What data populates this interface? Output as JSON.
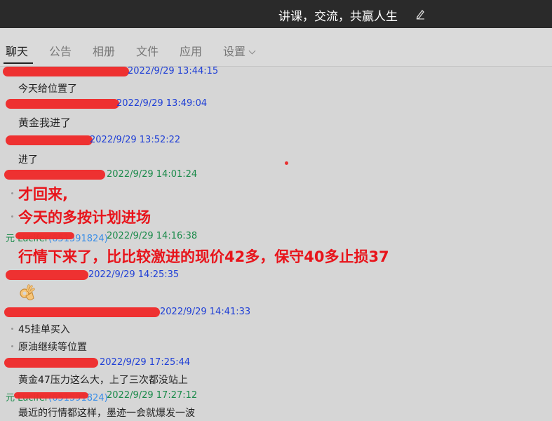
{
  "header": {
    "group_name": "讲课，交流，共赢人生"
  },
  "tabs": [
    {
      "label": "聊天",
      "active": true
    },
    {
      "label": "公告"
    },
    {
      "label": "相册"
    },
    {
      "label": "文件"
    },
    {
      "label": "应用"
    },
    {
      "label": "设置"
    }
  ],
  "messages": [
    {
      "time": "2022/9/29 13:44:15",
      "lines": [
        "今天给位置了"
      ]
    },
    {
      "time": "2022/9/29 13:49:04",
      "lines": [
        "黄金我进了"
      ]
    },
    {
      "time": "2022/9/29 13:52:22",
      "lines": [
        "进了"
      ]
    },
    {
      "time": "2022/9/29 14:01:24",
      "lines": [
        "才回来,",
        "今天的多按计划进场"
      ]
    },
    {
      "sender_prefix": "元 Lucifer",
      "sender_qq": "(651591824)",
      "time": "2022/9/29 14:16:38",
      "lines": [
        "行情下来了，比比较激进的现价42多，保守40多止损37"
      ]
    },
    {
      "time": "2022/9/29 14:25:35",
      "emoji": "ok-hand"
    },
    {
      "time": "2022/9/29 14:41:33",
      "lines": [
        "45挂单买入",
        "原油继续等位置"
      ]
    },
    {
      "time": "2022/9/29 17:25:44",
      "lines": [
        "黄金47压力这么大，上了三次都没站上"
      ]
    },
    {
      "sender_prefix": "元 Lucifer",
      "sender_qq": "(651591824)",
      "time": "2022/9/29 17:27:12",
      "lines": [
        "最近的行情都这样，墨迹一会就爆发一波"
      ]
    }
  ],
  "colors": {
    "time_blue": "#1f3fd6",
    "time_green": "#1a8a4a",
    "highlight_red": "#e8141b",
    "redaction": "#ee2b2b"
  }
}
